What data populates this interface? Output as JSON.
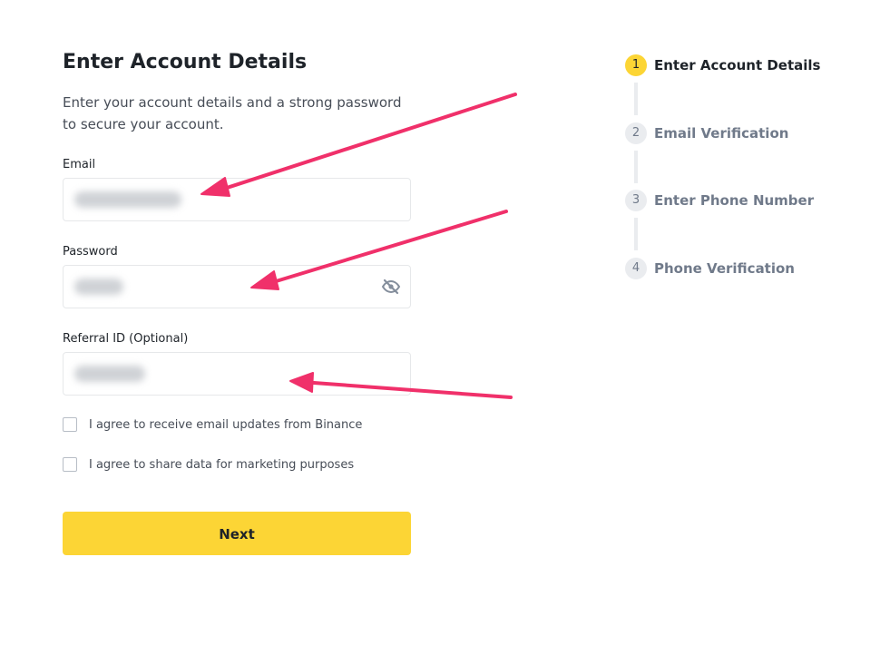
{
  "form": {
    "title": "Enter Account Details",
    "subtitle": "Enter your account details and a strong password to secure your account.",
    "email_label": "Email",
    "password_label": "Password",
    "referral_label": "Referral ID (Optional)",
    "checkbox_email_updates": "I agree to receive email updates from Binance",
    "checkbox_marketing": "I agree to share data for marketing purposes",
    "next_label": "Next"
  },
  "stepper": {
    "steps": [
      {
        "number": "1",
        "label": "Enter Account Details",
        "active": true
      },
      {
        "number": "2",
        "label": "Email Verification",
        "active": false
      },
      {
        "number": "3",
        "label": "Enter Phone Number",
        "active": false
      },
      {
        "number": "4",
        "label": "Phone Verification",
        "active": false
      }
    ]
  },
  "colors": {
    "accent": "#fcd535",
    "annotation_arrow": "#f0306a",
    "text_primary": "#1e2329",
    "text_secondary": "#707a8a",
    "border": "#e6e8ea"
  },
  "icons": {
    "password_toggle": "eye-slash-icon",
    "annotation": "arrow-icon"
  }
}
